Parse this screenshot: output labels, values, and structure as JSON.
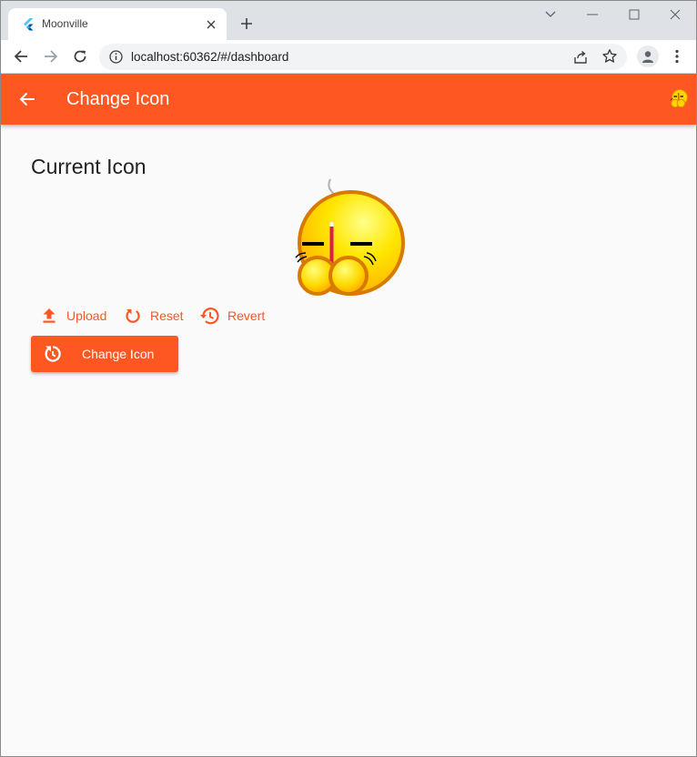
{
  "browser": {
    "tab_title": "Moonville",
    "url": "localhost:60362/#/dashboard",
    "icons": {
      "favicon": "flutter-icon",
      "close": "close-icon",
      "new_tab": "plus-icon",
      "back": "arrow-left-icon",
      "forward": "arrow-right-icon",
      "reload": "reload-icon",
      "info": "info-icon",
      "share": "share-icon",
      "bookmark": "star-icon",
      "profile": "profile-icon",
      "menu": "kebab-menu-icon"
    }
  },
  "appbar": {
    "title": "Change Icon",
    "color": "#ff5722"
  },
  "content": {
    "section_title": "Current Icon",
    "actions": [
      {
        "label": "Upload",
        "icon": "upload-icon"
      },
      {
        "label": "Reset",
        "icon": "reset-icon"
      },
      {
        "label": "Revert",
        "icon": "history-icon"
      }
    ],
    "primary_button": {
      "label": "Change Icon",
      "icon": "refresh-clock-icon"
    }
  },
  "colors": {
    "accent": "#ff5722",
    "background": "#fafafa",
    "title_text": "#212121"
  }
}
